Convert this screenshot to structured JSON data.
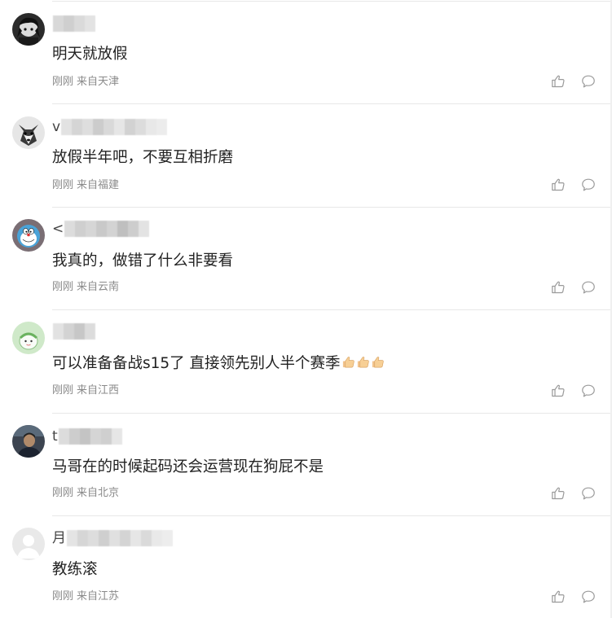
{
  "comments": [
    {
      "user_initial": "",
      "text": "明天就放假",
      "time": "刚刚",
      "location": "来自天津"
    },
    {
      "user_initial": "v",
      "text": "放假半年吧，不要互相折磨",
      "time": "刚刚",
      "location": "来自福建"
    },
    {
      "user_initial": "<",
      "text": "我真的，做错了什么非要看",
      "time": "刚刚",
      "location": "来自云南"
    },
    {
      "user_initial": "",
      "text": "可以准备备战s15了 直接领先别人半个赛季",
      "time": "刚刚",
      "location": "来自江西"
    },
    {
      "user_initial": "t",
      "text": "马哥在的时候起码还会运营现在狗屁不是",
      "time": "刚刚",
      "location": "来自北京"
    },
    {
      "user_initial": "月",
      "text": "教练滚",
      "time": "刚刚",
      "location": "来自江苏"
    }
  ],
  "icons": {
    "like": "thumbs-up-icon",
    "reply": "speech-bubble-icon",
    "emoji": "thumbs-up-emoji"
  },
  "colors": {
    "text": "#222222",
    "meta": "#8a8a8a",
    "icon": "#9a9a9a",
    "divider": "#e8e8e8"
  }
}
